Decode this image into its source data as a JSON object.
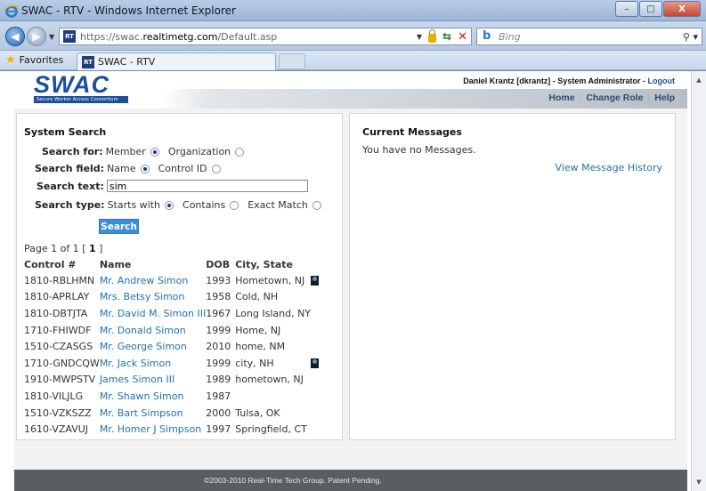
{
  "window": {
    "title": "SWAC - RTV - Windows Internet Explorer",
    "controls": [
      "–",
      "□",
      "X"
    ]
  },
  "address": {
    "favicon_text": "RT",
    "url_scheme_host": "https://swac.",
    "url_domain": "realtimetg.com",
    "url_path": "/Default.asp",
    "search_placeholder": "Bing",
    "bing_glyph": "b"
  },
  "favorites": {
    "label": "Favorites",
    "tab_title": "SWAC - RTV"
  },
  "header": {
    "logo_word": "SWAC",
    "logo_tagline": "Secure Worker Access Consortium",
    "user_info": "Daniel Krantz [dkrantz] - System Administrator - ",
    "logout_label": "Logout",
    "nav": [
      "Home",
      "Change Role",
      "Help"
    ]
  },
  "search": {
    "title": "System Search",
    "search_for_label": "Search for:",
    "search_for_options": [
      "Member",
      "Organization"
    ],
    "search_field_label": "Search field:",
    "search_field_options": [
      "Name",
      "Control ID"
    ],
    "search_text_label": "Search text:",
    "search_text_value": "sim",
    "search_type_label": "Search type:",
    "search_type_options": [
      "Starts with",
      "Contains",
      "Exact Match"
    ],
    "button_label": "Search",
    "pager_prefix": "Page 1 of 1 [ ",
    "pager_current": "1",
    "pager_suffix": " ]"
  },
  "results": {
    "columns": [
      "Control #",
      "Name",
      "DOB",
      "City, State"
    ],
    "rows": [
      {
        "control": "1810-RBLHMN",
        "name": "Mr. Andrew Simon",
        "dob": "1993",
        "city": "Hometown, NJ",
        "photo": true
      },
      {
        "control": "1810-APRLAY",
        "name": "Mrs. Betsy Simon",
        "dob": "1958",
        "city": "Cold, NH",
        "photo": false
      },
      {
        "control": "1810-DBTJTA",
        "name": "Mr. David M. Simon III",
        "dob": "1967",
        "city": "Long Island, NY",
        "photo": false
      },
      {
        "control": "1710-FHIWDF",
        "name": "Mr. Donald Simon",
        "dob": "1999",
        "city": "Home, NJ",
        "photo": false
      },
      {
        "control": "1510-CZASGS",
        "name": "Mr. George Simon",
        "dob": "2010",
        "city": "home, NM",
        "photo": false
      },
      {
        "control": "1710-GNDCQW",
        "name": "Mr. Jack Simon",
        "dob": "1999",
        "city": "city, NH",
        "photo": true
      },
      {
        "control": "1910-MWPSTV",
        "name": "James Simon III",
        "dob": "1989",
        "city": "hometown, NJ",
        "photo": false
      },
      {
        "control": "1810-VILJLG",
        "name": "Mr. Shawn Simon",
        "dob": "1987",
        "city": "",
        "photo": false
      },
      {
        "control": "1510-VZKSZZ",
        "name": "Mr. Bart Simpson",
        "dob": "2000",
        "city": "Tulsa, OK",
        "photo": false
      },
      {
        "control": "1610-VZAVUJ",
        "name": "Mr. Homer J Simpson",
        "dob": "1997",
        "city": "Springfield, CT",
        "photo": false
      }
    ]
  },
  "messages": {
    "title": "Current Messages",
    "empty_text": "You have no Messages.",
    "history_link": "View Message History"
  },
  "footer": {
    "text": "©2003-2010 Real-Time Tech Group. Patent Pending."
  }
}
